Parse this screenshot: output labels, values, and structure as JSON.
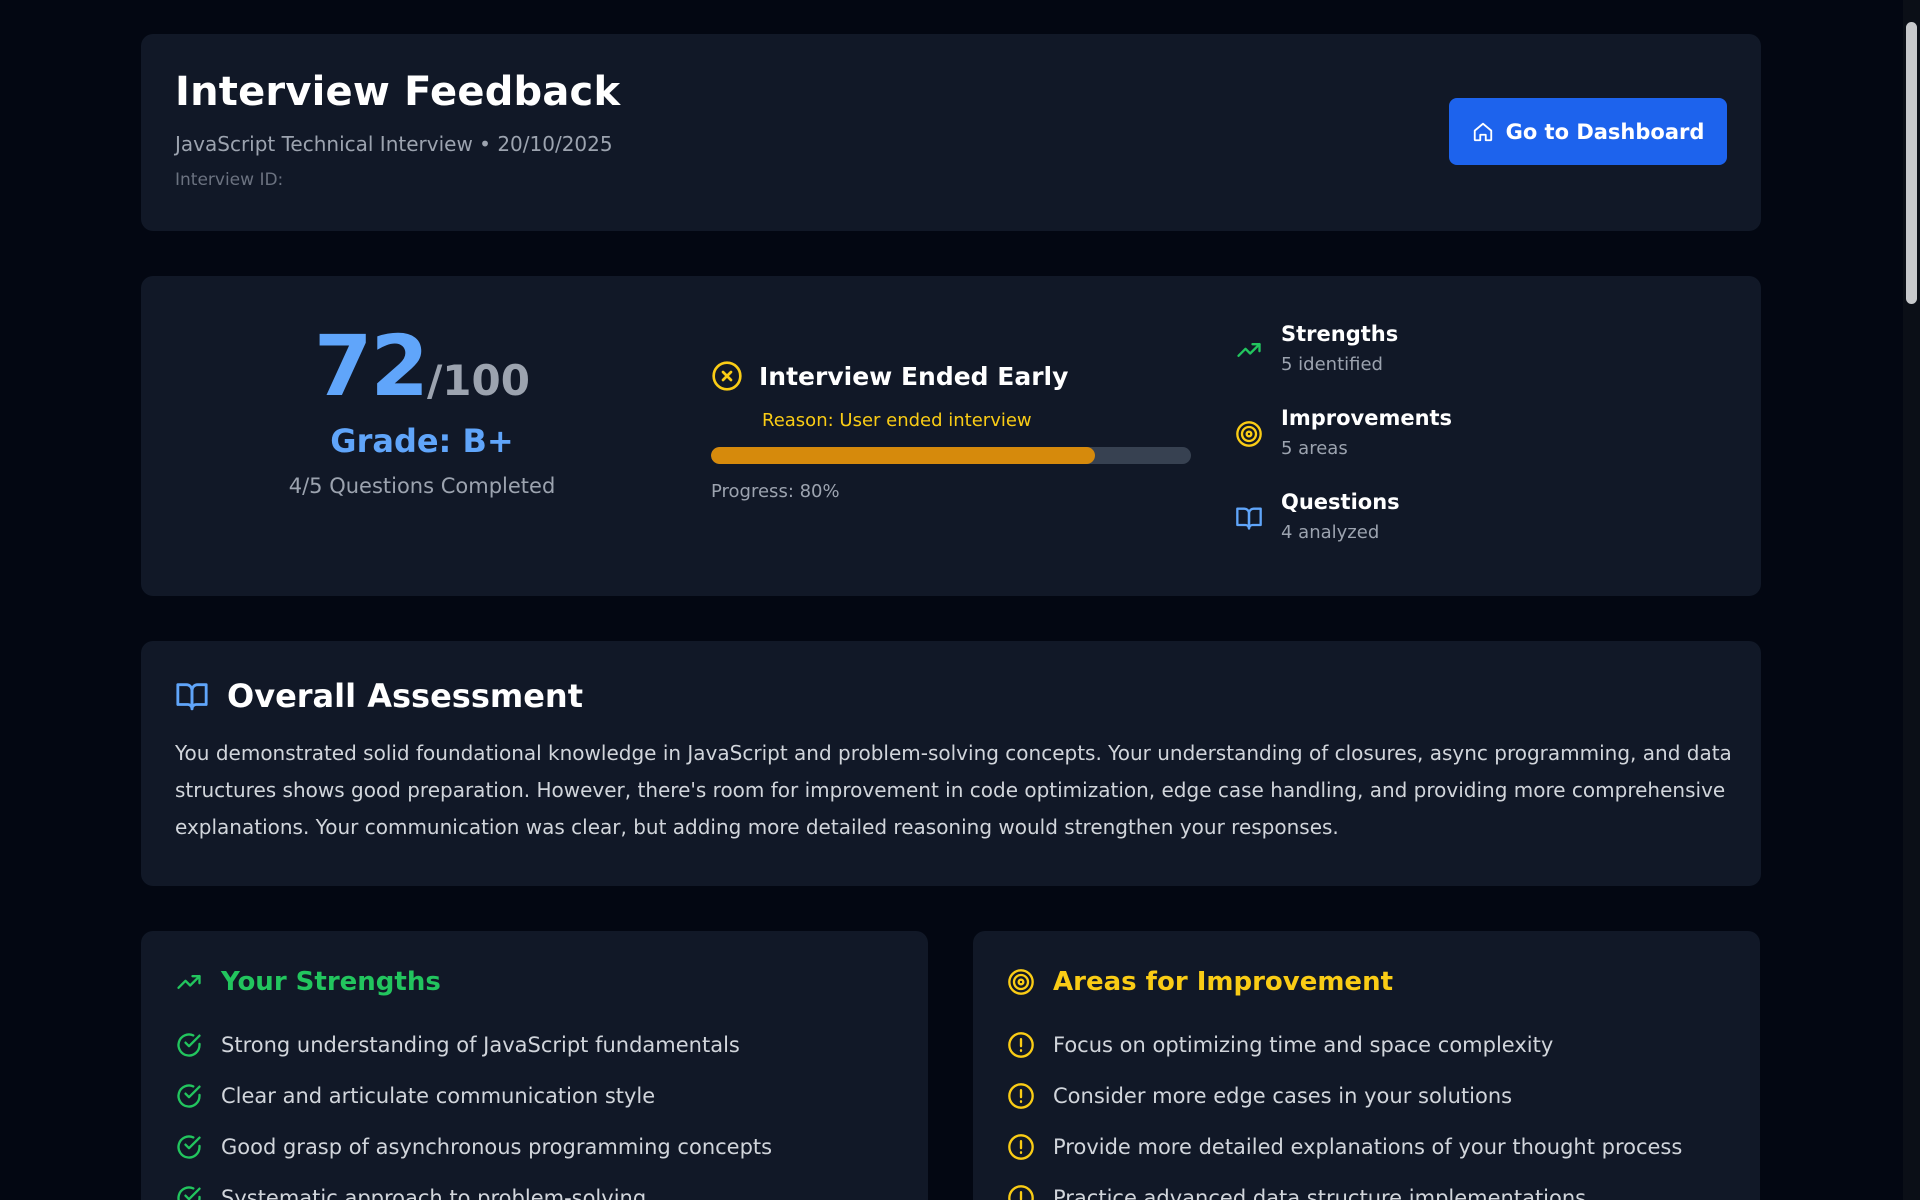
{
  "header": {
    "title": "Interview Feedback",
    "subtitle": "JavaScript Technical Interview • 20/10/2025",
    "interview_id_label": "Interview ID:",
    "dashboard_button": "Go to Dashboard"
  },
  "summary": {
    "score": "72",
    "score_max": "/100",
    "grade": "Grade: B+",
    "completed": "4/5 Questions Completed",
    "status_title": "Interview Ended Early",
    "status_reason": "Reason: User ended interview",
    "progress_percent": 80,
    "progress_label": "Progress: 80%",
    "stats": [
      {
        "title": "Strengths",
        "sub": "5 identified",
        "icon": "trending-up-icon"
      },
      {
        "title": "Improvements",
        "sub": "5 areas",
        "icon": "target-icon"
      },
      {
        "title": "Questions",
        "sub": "4 analyzed",
        "icon": "book-icon"
      }
    ]
  },
  "assessment": {
    "title": "Overall Assessment",
    "text": "You demonstrated solid foundational knowledge in JavaScript and problem-solving concepts. Your understanding of closures, async programming, and data structures shows good preparation. However, there's room for improvement in code optimization, edge case handling, and providing more comprehensive explanations. Your communication was clear, but adding more detailed reasoning would strengthen your responses."
  },
  "strengths": {
    "title": "Your Strengths",
    "items": [
      "Strong understanding of JavaScript fundamentals",
      "Clear and articulate communication style",
      "Good grasp of asynchronous programming concepts",
      "Systematic approach to problem-solving"
    ]
  },
  "improvements": {
    "title": "Areas for Improvement",
    "items": [
      "Focus on optimizing time and space complexity",
      "Consider more edge cases in your solutions",
      "Provide more detailed explanations of your thought process",
      "Practice advanced data structure implementations"
    ]
  },
  "colors": {
    "accent_blue": "#60a5fa",
    "button_blue": "#1d63ed",
    "success_green": "#22c55e",
    "warning_yellow": "#facc15",
    "progress_amber": "#d68a0c"
  }
}
